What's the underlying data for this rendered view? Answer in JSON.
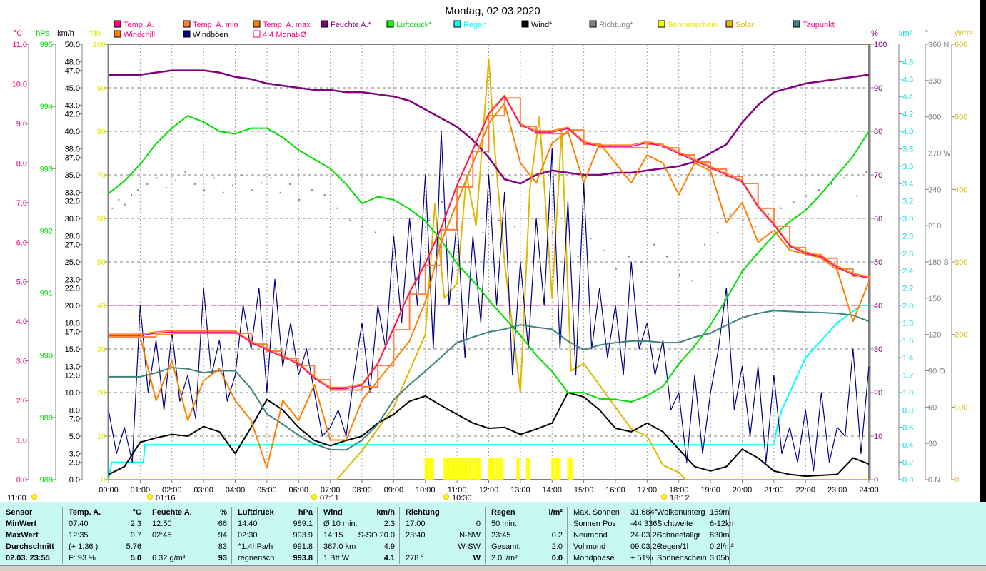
{
  "title": "Montag, 02.03.2020",
  "colors": {
    "temp": "#ff0080",
    "temp_min": "#ff8040",
    "temp_max": "#ff8000",
    "feuchte": "#800080",
    "luftdruck": "#00e000",
    "regen": "#00ffff",
    "wind": "#000000",
    "richtung": "#808080",
    "sonnenschein": "#ffff00",
    "solar": "#e0b800",
    "taupunkt": "#408080",
    "windchill": "#ff8000",
    "windboeen": "#000080",
    "monat": "#ff0080"
  },
  "legend": [
    {
      "label": "Temp. A.",
      "box": "#ff0080",
      "text": "#ff0080"
    },
    {
      "label": "Temp. A. min",
      "box": "#ff8040",
      "text": "#ff0080"
    },
    {
      "label": "Temp. A. max",
      "box": "#ff8000",
      "text": "#ff0080"
    },
    {
      "label": "Feuchte A.*",
      "box": "#800080",
      "text": "#800080"
    },
    {
      "label": "Luftdruck*",
      "box": "#00ff00",
      "text": "#00e000"
    },
    {
      "label": "Regen",
      "box": "#00ffff",
      "text": "#00ffff"
    },
    {
      "label": "Wind*",
      "box": "#000000",
      "text": "#000000"
    },
    {
      "label": "Richtung*",
      "box": "#808080",
      "text": "#808080"
    },
    {
      "label": "Sonnenschein",
      "box": "#ffff00",
      "text": "#e8e800"
    },
    {
      "label": "Solar",
      "box": "#e0b800",
      "text": "#e0b800"
    },
    {
      "label": "Taupunkt",
      "box": "#408080",
      "text": "#ff0080"
    },
    {
      "label": "Windchill",
      "box": "#ff8000",
      "text": "#ff0080"
    },
    {
      "label": "Windböen",
      "box": "#000080",
      "text": "#000000"
    },
    {
      "label": "4.4 Monat-Ø",
      "box": "#ffffff",
      "text": "#ff0080"
    }
  ],
  "axes": {
    "celsius": {
      "unit": "°C",
      "ticks": [
        "0.0",
        "1.0",
        "2.0",
        "3.0",
        "4.0",
        "5.0",
        "6.0",
        "7.0",
        "8.0",
        "9.0",
        "10.0",
        "11.0"
      ],
      "min": 0,
      "max": 11
    },
    "hpa": {
      "unit": "hPa",
      "ticks": [
        "988",
        "989",
        "990",
        "991",
        "992",
        "993",
        "994",
        "995"
      ],
      "min": 988,
      "max": 995
    },
    "kmh": {
      "unit": "km/h",
      "ticks": [
        "0.0",
        "2.0",
        "3.0",
        "5.0",
        "7.0",
        "8.0",
        "10.0",
        "12.0",
        "13.0",
        "15.0",
        "17.0",
        "18.0",
        "20.0",
        "22.0",
        "23.0",
        "25.0",
        "27.0",
        "28.0",
        "30.0",
        "32.0",
        "33.0",
        "35.0",
        "37.0",
        "38.0",
        "40.0",
        "42.0",
        "43.0",
        "45.0",
        "47.0",
        "48.0",
        "50.0"
      ],
      "min": 0,
      "max": 50
    },
    "min": {
      "unit": "min",
      "ticks": [
        "0",
        "10",
        "20",
        "30",
        "40",
        "50",
        "60",
        "70",
        "80",
        "90",
        "100"
      ],
      "min": 0,
      "max": 100
    },
    "pct": {
      "unit": "%",
      "ticks": [
        "0",
        "10",
        "20",
        "30",
        "40",
        "50",
        "60",
        "70",
        "80",
        "90",
        "100"
      ],
      "min": 0,
      "max": 100
    },
    "rain": {
      "unit": "l/m²",
      "ticks": [
        "0.0",
        "0.2",
        "0.4",
        "0.6",
        "0.8",
        "1.0",
        "1.2",
        "1.4",
        "1.6",
        "1.8",
        "2.0",
        "2.2",
        "2.4",
        "2.6",
        "2.8",
        "3.0",
        "3.2",
        "3.4",
        "3.6",
        "3.8",
        "4.0",
        "4.2",
        "4.4",
        "4.6",
        "4.8"
      ],
      "min": 0,
      "max": 5
    },
    "deg": {
      "unit": "°",
      "ticks": [
        "0  N",
        "30",
        "60",
        "90  O",
        "120",
        "150",
        "180 S",
        "210",
        "240",
        "270 W",
        "300",
        "330",
        "360 N"
      ],
      "min": 0,
      "max": 360
    },
    "wm2": {
      "unit": "W/m²",
      "ticks": [
        "0",
        "100",
        "200",
        "300",
        "400",
        "500",
        "600"
      ],
      "min": 0,
      "max": 600
    },
    "time": {
      "ticks": [
        "00:00",
        "01:00",
        "02:00",
        "03:00",
        "04:00",
        "05:00",
        "06:00",
        "07:00",
        "08:00",
        "09:00",
        "10:00",
        "11:00",
        "12:00",
        "13:00",
        "14:00",
        "15:00",
        "16:00",
        "17:00",
        "18:00",
        "19:00",
        "20:00",
        "21:00",
        "22:00",
        "23:00",
        "24:00"
      ]
    }
  },
  "events": [
    {
      "label": "11:00",
      "icon": "moon-icon"
    },
    {
      "label": "01:16",
      "icon": "moonset-icon"
    },
    {
      "label": "07:11",
      "icon": "sunrise-icon"
    },
    {
      "label": "10:30",
      "icon": "moonrise-icon"
    },
    {
      "label": "18:12",
      "icon": "sunset-icon"
    }
  ],
  "chart_data": {
    "type": "line",
    "title": "Montag, 02.03.2020",
    "x_unit": "hours",
    "step_halfhour": 0.5,
    "series": {
      "temp": [
        3.64,
        3.64,
        3.64,
        3.7,
        3.73,
        3.73,
        3.73,
        3.73,
        3.73,
        3.46,
        3.28,
        3.1,
        2.92,
        2.56,
        2.3,
        2.3,
        2.38,
        2.92,
        3.82,
        4.72,
        5.45,
        6.35,
        7.43,
        8.33,
        9.23,
        9.68,
        8.96,
        8.78,
        8.78,
        8.87,
        8.51,
        8.42,
        8.42,
        8.42,
        8.51,
        8.42,
        8.24,
        8.06,
        7.88,
        7.7,
        7.52,
        6.89,
        6.44,
        5.9,
        5.72,
        5.63,
        5.36,
        5.18,
        5.09
      ],
      "windchill": [
        3.6,
        3.6,
        3.6,
        2.0,
        3.0,
        1.5,
        2.5,
        2.8,
        2.0,
        1.5,
        0.3,
        2.0,
        1.5,
        2.4,
        1.0,
        1.0,
        2.0,
        2.5,
        3.0,
        3.5,
        4.5,
        6,
        7,
        8,
        9,
        9.5,
        8,
        7.5,
        8.5,
        8.8,
        7.5,
        8.5,
        8,
        7.5,
        8.2,
        8,
        7.2,
        8,
        7.8,
        6.5,
        7,
        6,
        6.3,
        5.8,
        5.7,
        5.6,
        5.3,
        4.0,
        5.0
      ],
      "feuchte": [
        93,
        93,
        93,
        93.5,
        94,
        94,
        94,
        93.5,
        92.5,
        92,
        91,
        90.5,
        90,
        89.5,
        89.5,
        89,
        89,
        88.5,
        88,
        87,
        85,
        83,
        81,
        78,
        74,
        69,
        68,
        70,
        71,
        70.5,
        70,
        70,
        70.5,
        70.5,
        71,
        71.5,
        72,
        73,
        75,
        77,
        82,
        86,
        89,
        90,
        91,
        91.5,
        92,
        92.5,
        93
      ],
      "luftdruck": [
        992.6,
        992.8,
        993.07,
        993.4,
        993.65,
        993.85,
        993.75,
        993.6,
        993.56,
        993.65,
        993.65,
        993.5,
        993.3,
        993.15,
        993.0,
        992.75,
        992.44,
        992.55,
        992.5,
        992.35,
        992.16,
        991.85,
        991.47,
        991.2,
        990.89,
        990.6,
        990.32,
        990.0,
        989.74,
        989.4,
        989.4,
        989.3,
        989.29,
        989.25,
        989.35,
        989.5,
        989.86,
        990.15,
        990.49,
        990.9,
        991.35,
        991.65,
        991.93,
        992.15,
        992.33,
        992.6,
        992.9,
        993.2,
        993.6
      ],
      "taupunkt": [
        2.6,
        2.6,
        2.6,
        2.7,
        2.83,
        2.8,
        2.7,
        2.75,
        2.75,
        2.3,
        1.66,
        1.4,
        1.12,
        0.9,
        0.76,
        0.75,
        1.0,
        1.4,
        2.02,
        2.4,
        2.74,
        3.1,
        3.46,
        3.6,
        3.73,
        3.8,
        3.91,
        3.85,
        3.8,
        3.5,
        3.28,
        3.4,
        3.46,
        3.5,
        3.5,
        3.46,
        3.46,
        3.6,
        3.7,
        3.9,
        4.09,
        4.2,
        4.27,
        4.25,
        4.23,
        4.22,
        4.2,
        4.15,
        4.0
      ],
      "wind": [
        0.6,
        1.5,
        4.3,
        4.8,
        5.2,
        5.0,
        6.1,
        5.5,
        3.0,
        6,
        9.2,
        8,
        6,
        4.5,
        3.9,
        4.5,
        5,
        6.5,
        7.5,
        9,
        9.6,
        8.5,
        7.5,
        6.5,
        5.9,
        6,
        5.2,
        5.8,
        6.5,
        10,
        9.5,
        8,
        5.9,
        5.5,
        6.5,
        5.5,
        3.5,
        1.5,
        1,
        1.5,
        3.5,
        2.5,
        1,
        0.6,
        0.4,
        0.5,
        0.6,
        2.5,
        1.8
      ],
      "windboeen_quarterhour": [
        8,
        3,
        6,
        2,
        20,
        10,
        16,
        8,
        17,
        9,
        12,
        7,
        22,
        12,
        16,
        9,
        12,
        20,
        15,
        22,
        10,
        23,
        13,
        18,
        12,
        15,
        10,
        5,
        6,
        8,
        5,
        12,
        18,
        10,
        20,
        15,
        28,
        18,
        30,
        20,
        35,
        15,
        40,
        20,
        30,
        14,
        28,
        18,
        35,
        20,
        33,
        12,
        25,
        15,
        30,
        20,
        38,
        15,
        32,
        12,
        34,
        15,
        22,
        14,
        20,
        12,
        25,
        15,
        18,
        12,
        16,
        8,
        10,
        2,
        12,
        3,
        10,
        15,
        22,
        8,
        13,
        5,
        13,
        2,
        12,
        3,
        6,
        2,
        8,
        1,
        10,
        2,
        6,
        5,
        15,
        3,
        13
      ],
      "solar": [
        [
          0,
          0
        ],
        [
          7.2,
          0
        ],
        [
          8,
          40
        ],
        [
          9,
          100
        ],
        [
          9.5,
          150
        ],
        [
          10,
          200
        ],
        [
          10.3,
          380
        ],
        [
          10.6,
          250
        ],
        [
          11,
          270
        ],
        [
          11.3,
          420
        ],
        [
          11.6,
          350
        ],
        [
          12,
          580
        ],
        [
          12.2,
          450
        ],
        [
          12.5,
          300
        ],
        [
          13,
          120
        ],
        [
          13.3,
          400
        ],
        [
          13.6,
          500
        ],
        [
          14,
          250
        ],
        [
          14.3,
          480
        ],
        [
          14.6,
          150
        ],
        [
          15,
          160
        ],
        [
          15.5,
          130
        ],
        [
          16,
          100
        ],
        [
          16.5,
          70
        ],
        [
          17,
          60
        ],
        [
          17.5,
          20
        ],
        [
          18,
          10
        ],
        [
          18.2,
          0
        ],
        [
          24,
          0
        ]
      ],
      "regen_sum": [
        [
          0,
          0
        ],
        [
          0.1,
          0.2
        ],
        [
          1.1,
          0.2
        ],
        [
          1.15,
          0.4
        ],
        [
          21,
          0.4
        ],
        [
          21.1,
          0.6
        ],
        [
          21.25,
          0.8
        ],
        [
          21.5,
          1.0
        ],
        [
          21.75,
          1.2
        ],
        [
          22,
          1.4
        ],
        [
          22.5,
          1.6
        ],
        [
          23,
          1.8
        ],
        [
          23.75,
          2.0
        ],
        [
          24,
          2.0
        ]
      ],
      "sonnenschein": [
        [
          10.0,
          10.3
        ],
        [
          10.6,
          11.8
        ],
        [
          12.0,
          12.5
        ],
        [
          12.9,
          13.0
        ],
        [
          13.2,
          13.3
        ],
        [
          14.0,
          14.3
        ],
        [
          14.5,
          14.7
        ]
      ],
      "richtung": [
        [
          0.1,
          225
        ],
        [
          0.3,
          232
        ],
        [
          0.5,
          228
        ],
        [
          0.7,
          236
        ],
        [
          0.9,
          240
        ],
        [
          1.2,
          245
        ],
        [
          1.5,
          250
        ],
        [
          1.8,
          242
        ],
        [
          2.1,
          248
        ],
        [
          2.4,
          255
        ],
        [
          2.7,
          245
        ],
        [
          3.0,
          240
        ],
        [
          3.3,
          250
        ],
        [
          3.6,
          238
        ],
        [
          3.9,
          244
        ],
        [
          4.2,
          252
        ],
        [
          4.5,
          240
        ],
        [
          4.8,
          246
        ],
        [
          5.1,
          250
        ],
        [
          5.4,
          238
        ],
        [
          5.7,
          245
        ],
        [
          6.0,
          232
        ],
        [
          6.4,
          240
        ],
        [
          6.8,
          236
        ],
        [
          7.2,
          225
        ],
        [
          7.6,
          215
        ],
        [
          8.0,
          210
        ],
        [
          8.4,
          205
        ],
        [
          8.8,
          215
        ],
        [
          9.2,
          225
        ],
        [
          9.6,
          200
        ],
        [
          10.1,
          215
        ],
        [
          10.5,
          230
        ],
        [
          11.0,
          235
        ],
        [
          11.5,
          225
        ],
        [
          11.8,
          205
        ],
        [
          12.3,
          215
        ],
        [
          12.8,
          210
        ],
        [
          13.2,
          195
        ],
        [
          13.6,
          180
        ],
        [
          14.0,
          205
        ],
        [
          14.4,
          190
        ],
        [
          14.8,
          185
        ],
        [
          15.2,
          200
        ],
        [
          15.6,
          190
        ],
        [
          16.0,
          175
        ],
        [
          16.4,
          185
        ],
        [
          16.8,
          180
        ],
        [
          17.2,
          195
        ],
        [
          17.6,
          185
        ],
        [
          18.0,
          170
        ],
        [
          18.4,
          165
        ],
        [
          18.8,
          195
        ],
        [
          19.2,
          205
        ],
        [
          19.6,
          220
        ],
        [
          20.0,
          215
        ],
        [
          20.4,
          210
        ],
        [
          20.8,
          220
        ],
        [
          21.2,
          225
        ],
        [
          21.6,
          230
        ],
        [
          22.0,
          235
        ],
        [
          22.4,
          240
        ],
        [
          22.8,
          245
        ],
        [
          23.2,
          250
        ],
        [
          23.6,
          235
        ],
        [
          23.9,
          255
        ]
      ]
    },
    "monat_avg_celsius": 4.4
  },
  "table": {
    "cols": [
      {
        "head": [
          "Sensor",
          ""
        ],
        "rows": [
          [
            "MinWert",
            ""
          ],
          [
            "MaxWert",
            ""
          ],
          [
            "Durchschnitt",
            ""
          ],
          [
            "02.03. 23:55",
            ""
          ]
        ]
      },
      {
        "head": [
          "Temp. A.",
          "°C"
        ],
        "rows": [
          [
            "07:40",
            "2.3"
          ],
          [
            "12:35",
            "9.7"
          ],
          [
            "(+ 1.36 )",
            "5.76"
          ],
          [
            "F: 93 %",
            "5.0"
          ]
        ]
      },
      {
        "head": [
          "Feuchte A.",
          "%"
        ],
        "rows": [
          [
            "12:50",
            "66"
          ],
          [
            "02:45",
            "94"
          ],
          [
            "",
            "83"
          ],
          [
            "6.32 g/m³",
            "93"
          ]
        ]
      },
      {
        "head": [
          "Luftdruck",
          "hPa"
        ],
        "rows": [
          [
            "14:40",
            "989.1"
          ],
          [
            "02:30",
            "993.9"
          ],
          [
            "^1.4hPa/h",
            "991.8"
          ],
          [
            "regnerisch",
            "↑993.8"
          ]
        ]
      },
      {
        "head": [
          "Wind",
          "km/h"
        ],
        "rows": [
          [
            "Ø 10 min.",
            "2.3"
          ],
          [
            "14:15",
            "S-SO 20.0"
          ],
          [
            "367.0 km",
            "4.9"
          ],
          [
            "1 Bft W",
            "4.1"
          ]
        ]
      },
      {
        "head": [
          "Richtung",
          ""
        ],
        "rows": [
          [
            "17:00",
            "0"
          ],
          [
            "23:40",
            "N-NW"
          ],
          [
            "",
            "W-SW"
          ],
          [
            "278 °",
            "W"
          ]
        ]
      },
      {
        "head": [
          "Regen",
          "l/m²"
        ],
        "rows": [
          [
            "50 min.",
            ""
          ],
          [
            "23:45",
            "0.2"
          ],
          [
            "Gesamt:",
            "2.0"
          ],
          [
            "2.0 l/m²",
            "0.0"
          ]
        ]
      },
      {
        "head": [
          "Max. Sonnen",
          "31,684°"
        ],
        "rows": [
          [
            "Sonnen Pos",
            "-44,336°"
          ],
          [
            "Neumond",
            "24.03.20"
          ],
          [
            "Vollmond",
            "09.03.20"
          ],
          [
            "Mondphase",
            "+ 51%"
          ]
        ]
      },
      {
        "head": [
          "Wolkenunterg",
          "159m"
        ],
        "rows": [
          [
            "Sichtweite",
            "6-12km"
          ],
          [
            "Schneefallgr",
            "830m"
          ],
          [
            "Regen/1h",
            "0.2l/m²"
          ],
          [
            "Sonnenschein",
            "3:05h"
          ]
        ]
      }
    ]
  }
}
